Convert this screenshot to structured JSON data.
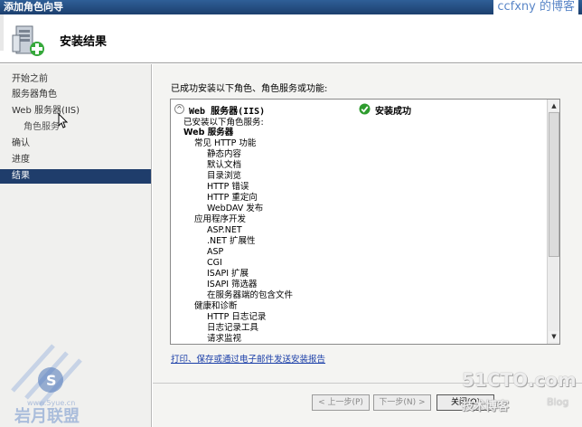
{
  "window": {
    "title": "添加角色向导",
    "watermark_top": "ccfxny 的博客"
  },
  "header": {
    "title": "安装结果",
    "icon": "server-install-icon"
  },
  "nav": {
    "items": [
      {
        "label": "开始之前",
        "active": false,
        "sub": false
      },
      {
        "label": "服务器角色",
        "active": false,
        "sub": false
      },
      {
        "label": "Web 服务器(IIS)",
        "active": false,
        "sub": false
      },
      {
        "label": "角色服务",
        "active": false,
        "sub": true
      },
      {
        "label": "确认",
        "active": false,
        "sub": false
      },
      {
        "label": "进度",
        "active": false,
        "sub": false
      },
      {
        "label": "结果",
        "active": true,
        "sub": false
      }
    ]
  },
  "main": {
    "description": "已成功安装以下角色、角色服务或功能:",
    "panel": {
      "role_name": "Web 服务器(IIS)",
      "status": "安装成功",
      "status_icon": "check-circle-icon",
      "collapse_icon": "collapse-icon",
      "lines": [
        {
          "text": "已安装以下角色服务:",
          "level": 0,
          "bold": false
        },
        {
          "text": "Web 服务器",
          "level": 0,
          "bold": true
        },
        {
          "text": "常见 HTTP 功能",
          "level": 1,
          "bold": false
        },
        {
          "text": "静态内容",
          "level": 2,
          "bold": false
        },
        {
          "text": "默认文档",
          "level": 2,
          "bold": false
        },
        {
          "text": "目录浏览",
          "level": 2,
          "bold": false
        },
        {
          "text": "HTTP 错误",
          "level": 2,
          "bold": false
        },
        {
          "text": "HTTP 重定向",
          "level": 2,
          "bold": false
        },
        {
          "text": "WebDAV 发布",
          "level": 2,
          "bold": false
        },
        {
          "text": "应用程序开发",
          "level": 1,
          "bold": false
        },
        {
          "text": "ASP.NET",
          "level": 2,
          "bold": false
        },
        {
          "text": ".NET 扩展性",
          "level": 2,
          "bold": false
        },
        {
          "text": "ASP",
          "level": 2,
          "bold": false
        },
        {
          "text": "CGI",
          "level": 2,
          "bold": false
        },
        {
          "text": "ISAPI 扩展",
          "level": 2,
          "bold": false
        },
        {
          "text": "ISAPI 筛选器",
          "level": 2,
          "bold": false
        },
        {
          "text": "在服务器端的包含文件",
          "level": 2,
          "bold": false
        },
        {
          "text": "健康和诊断",
          "level": 1,
          "bold": false
        },
        {
          "text": "HTTP 日志记录",
          "level": 2,
          "bold": false
        },
        {
          "text": "日志记录工具",
          "level": 2,
          "bold": false
        },
        {
          "text": "请求监视",
          "level": 2,
          "bold": false
        }
      ]
    },
    "report_link": "打印、保存或通过电子邮件发送安装报告"
  },
  "buttons": {
    "back": "< 上一步(P)",
    "next": "下一步(N) >",
    "close": "关闭(O)"
  },
  "watermarks": {
    "site": "51CTO.com",
    "sub": "技术博客",
    "blog": "Blog",
    "left_cn": "岩月联盟",
    "left_url": "www.5yue.cn"
  },
  "colors": {
    "titlebar": "#1c3f6e",
    "nav_active": "#1f3d6b",
    "link": "#1a3ea8",
    "success": "#2e9c2e"
  }
}
